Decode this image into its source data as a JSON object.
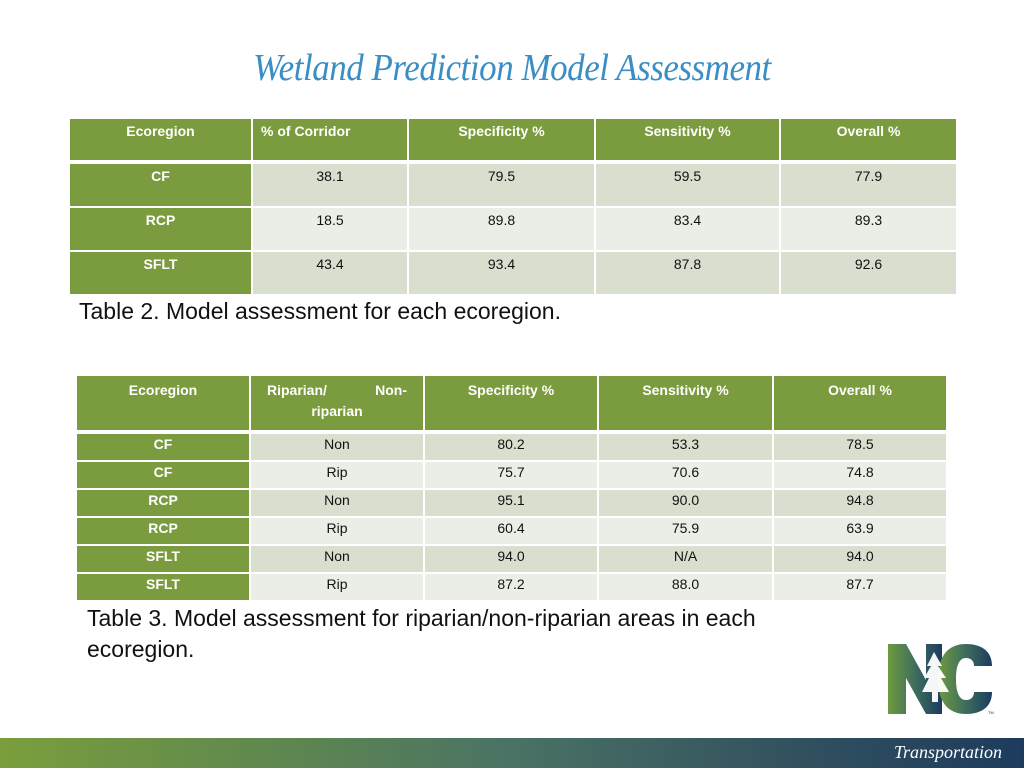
{
  "slide": {
    "title": "Wetland Prediction Model Assessment"
  },
  "table2": {
    "headers": [
      "Ecoregion",
      "% of Corridor",
      "Specificity %",
      "Sensitivity %",
      "Overall %"
    ],
    "rows": [
      {
        "ecoregion": "CF",
        "corridor": "38.1",
        "specificity": "79.5",
        "sensitivity": "59.5",
        "overall": "77.9"
      },
      {
        "ecoregion": "RCP",
        "corridor": "18.5",
        "specificity": "89.8",
        "sensitivity": "83.4",
        "overall": "89.3"
      },
      {
        "ecoregion": "SFLT",
        "corridor": "43.4",
        "specificity": "93.4",
        "sensitivity": "87.8",
        "overall": "92.6"
      }
    ],
    "caption": "Table 2.  Model assessment for each ecoregion."
  },
  "table3": {
    "headers": {
      "ecoregion": "Ecoregion",
      "riparian_line1_left": "Riparian/",
      "riparian_line1_right": "Non-",
      "riparian_line2": "riparian",
      "specificity": "Specificity %",
      "sensitivity": "Sensitivity %",
      "overall": "Overall %"
    },
    "rows": [
      {
        "ecoregion": "CF",
        "type": "Non",
        "specificity": "80.2",
        "sensitivity": "53.3",
        "overall": "78.5"
      },
      {
        "ecoregion": "CF",
        "type": "Rip",
        "specificity": "75.7",
        "sensitivity": "70.6",
        "overall": "74.8"
      },
      {
        "ecoregion": "RCP",
        "type": "Non",
        "specificity": "95.1",
        "sensitivity": "90.0",
        "overall": "94.8"
      },
      {
        "ecoregion": "RCP",
        "type": "Rip",
        "specificity": "60.4",
        "sensitivity": "75.9",
        "overall": "63.9"
      },
      {
        "ecoregion": "SFLT",
        "type": "Non",
        "specificity": "94.0",
        "sensitivity": "N/A",
        "overall": "94.0"
      },
      {
        "ecoregion": "SFLT",
        "type": "Rip",
        "specificity": "87.2",
        "sensitivity": "88.0",
        "overall": "87.7"
      }
    ],
    "caption": "Table 3.  Model assessment for riparian/non-riparian areas in each ecoregion."
  },
  "branding": {
    "logo_text": "NC",
    "logo_icon": "tree-icon",
    "footer_label": "Transportation"
  },
  "colors": {
    "header_green": "#7b9c3e",
    "title_blue": "#3a8ec4",
    "row_dark": "#d8dfcf",
    "row_light": "#ebeee7",
    "footer_navy": "#1d3b5e"
  }
}
